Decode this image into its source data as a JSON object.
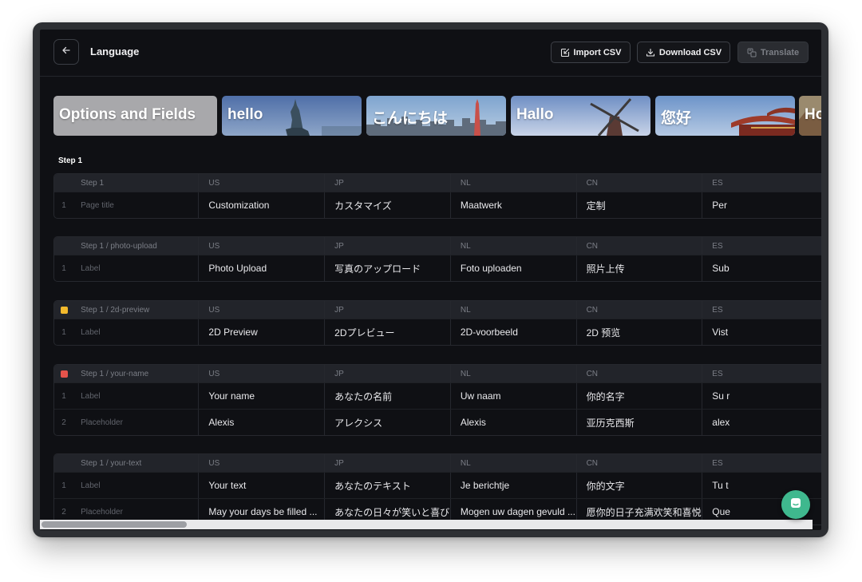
{
  "header": {
    "title": "Language",
    "import_label": "Import CSV",
    "download_label": "Download CSV",
    "translate_label": "Translate"
  },
  "tiles": [
    "Options and Fields",
    "hello",
    "こんにちは",
    "Hallo",
    "您好",
    "Ho"
  ],
  "step_heading": "Step 1",
  "columns": [
    "US",
    "JP",
    "NL",
    "CN",
    "ES"
  ],
  "tables": [
    {
      "path": "Step 1",
      "status": null,
      "rows": [
        {
          "num": "1",
          "field": "Page title",
          "us": "Customization",
          "jp": "カスタマイズ",
          "nl": "Maatwerk",
          "cn": "定制",
          "es": "Per"
        }
      ]
    },
    {
      "path": "Step 1 / photo-upload",
      "status": null,
      "rows": [
        {
          "num": "1",
          "field": "Label",
          "us": "Photo Upload",
          "jp": "写真のアップロード",
          "nl": "Foto uploaden",
          "cn": "照片上传",
          "es": "Sub"
        }
      ]
    },
    {
      "path": "Step 1 / 2d-preview",
      "status": "#f2b92c",
      "rows": [
        {
          "num": "1",
          "field": "Label",
          "us": "2D Preview",
          "jp": "2Dプレビュー",
          "nl": "2D-voorbeeld",
          "cn": "2D 预览",
          "es": "Vist"
        }
      ]
    },
    {
      "path": "Step 1 / your-name",
      "status": "#e5534b",
      "rows": [
        {
          "num": "1",
          "field": "Label",
          "us": "Your name",
          "jp": "あなたの名前",
          "nl": "Uw naam",
          "cn": "你的名字",
          "es": "Su r"
        },
        {
          "num": "2",
          "field": "Placeholder",
          "us": "Alexis",
          "jp": "アレクシス",
          "nl": "Alexis",
          "cn": "亚历克西斯",
          "es": "alex"
        }
      ]
    },
    {
      "path": "Step 1 / your-text",
      "status": null,
      "rows": [
        {
          "num": "1",
          "field": "Label",
          "us": "Your text",
          "jp": "あなたのテキスト",
          "nl": "Je berichtje",
          "cn": "你的文字",
          "es": "Tu t"
        },
        {
          "num": "2",
          "field": "Placeholder",
          "us": "May your days be filled ...",
          "jp": "あなたの日々が笑いと喜び...",
          "nl": "Mogen uw dagen gevuld ...",
          "cn": "愿你的日子充满欢笑和喜悦",
          "es": "Que"
        }
      ]
    }
  ],
  "icons": {
    "back": "arrow-left-icon",
    "import": "import-icon",
    "download": "download-icon",
    "translate": "translate-icon",
    "chat": "chat-icon"
  },
  "colors": {
    "accent_chat": "#3fb88e",
    "status_yellow": "#f2b92c",
    "status_red": "#e5534b"
  }
}
